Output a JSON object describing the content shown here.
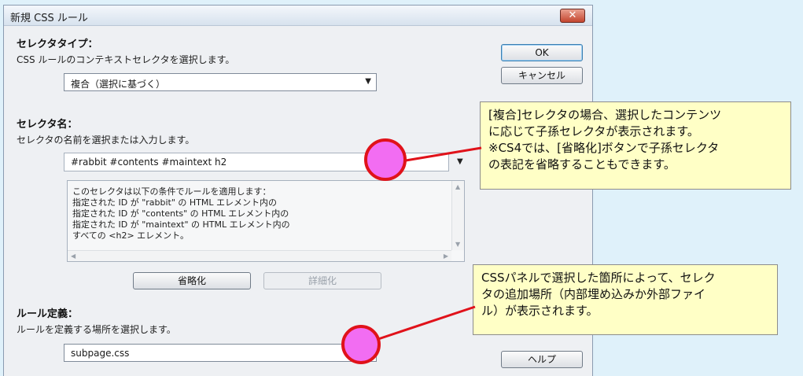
{
  "dialog": {
    "title": "新規 CSS ルール",
    "close_label": "✕"
  },
  "selector_type": {
    "label": "セレクタタイプ：",
    "hint": "CSS ルールのコンテキストセレクタを選択します。",
    "value": "複合（選択に基づく）"
  },
  "selector_name": {
    "label": "セレクタ名：",
    "hint": "セレクタの名前を選択または入力します。",
    "value": "#rabbit #contents #maintext h2",
    "description": [
      "このセレクタは以下の条件でルールを適用します：",
      "指定された ID が \"rabbit\" の HTML エレメント内の",
      "指定された ID が \"contents\" の HTML エレメント内の",
      "指定された ID が \"maintext\" の HTML エレメント内の",
      "すべての <h2> エレメント。"
    ],
    "less_specific_label": "省略化",
    "more_specific_label": "詳細化"
  },
  "rule_definition": {
    "label": "ルール定義：",
    "hint": "ルールを定義する場所を選択します。",
    "value": "subpage.css"
  },
  "buttons": {
    "ok": "OK",
    "cancel": "キャンセル",
    "help": "ヘルプ"
  },
  "callouts": {
    "first": [
      "[複合]セレクタの場合、選択したコンテンツ",
      "に応じて子孫セレクタが表示されます。",
      "※CS4では、[省略化]ボタンで子孫セレクタ",
      "の表記を省略することもできます。"
    ],
    "second": [
      "CSSパネルで選択した箇所によって、セレク",
      "タの追加場所（内部埋め込みか外部ファイ",
      "ル）が表示されます。"
    ]
  },
  "colors": {
    "marker_fill": "#f26df2",
    "marker_stroke": "#e0121a",
    "callout_line": "#e0121a",
    "callout_bg": "#ffffc6"
  },
  "icons": {
    "dropdown": "chevron-down-icon",
    "close": "close-icon"
  }
}
